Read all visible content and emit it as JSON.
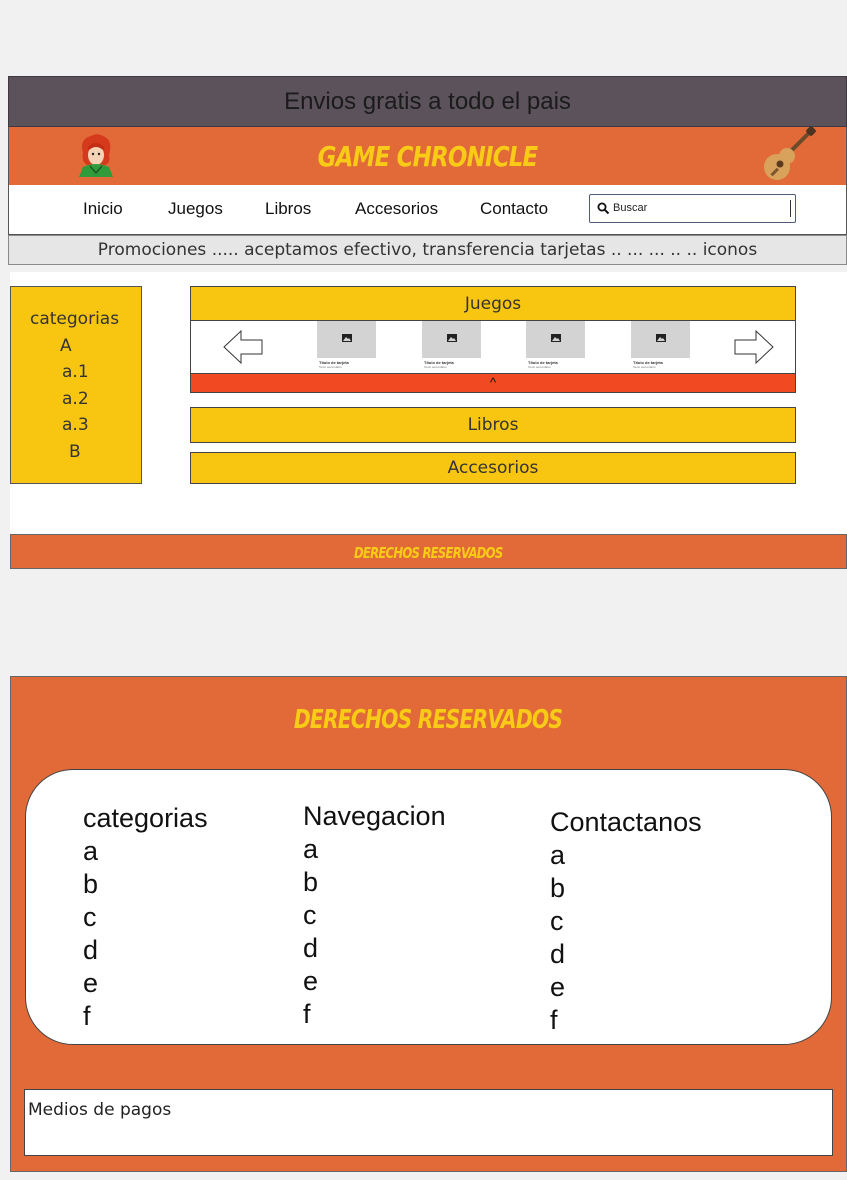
{
  "top_banner": {
    "text": "Envios gratis a todo el pais"
  },
  "header": {
    "brand": "GAME CHRONICLE"
  },
  "nav": {
    "items": [
      "Inicio",
      "Juegos",
      "Libros",
      "Accesorios",
      "Contacto"
    ],
    "search_placeholder": "Buscar"
  },
  "promo": {
    "text": "Promociones ..... aceptamos efectivo, transferencia tarjetas .. ... ... .. .. iconos"
  },
  "sidebar": {
    "title": "categorias",
    "items": [
      "A",
      "a.1",
      "a.2",
      "a.3",
      "B"
    ]
  },
  "sections": {
    "games": "Juegos",
    "carousel_toggle": "^",
    "cards": [
      {
        "title": "Título de tarjeta",
        "subtitle": "Texto secundario"
      },
      {
        "title": "Título de tarjeta",
        "subtitle": "Texto secundario"
      },
      {
        "title": "Título de tarjeta",
        "subtitle": "Texto secundario"
      },
      {
        "title": "Título de tarjeta",
        "subtitle": "Texto secundario"
      }
    ],
    "books": "Libros",
    "accessories": "Accesorios"
  },
  "footer_small": {
    "text": "DERECHOS RESERVADOS"
  },
  "footer": {
    "title": "DERECHOS RESERVADOS",
    "columns": [
      {
        "heading": "categorias",
        "items": [
          "a",
          "b",
          "c",
          "d",
          "e",
          "f"
        ]
      },
      {
        "heading": "Navegacion",
        "items": [
          "a",
          "b",
          "c",
          "d",
          "e",
          "f"
        ]
      },
      {
        "heading": "Contactanos",
        "items": [
          "a",
          "b",
          "c",
          "d",
          "e",
          "f"
        ]
      }
    ],
    "payments": "Medios de pagos"
  },
  "colors": {
    "orange": "#e26a38",
    "yellow": "#f8c610",
    "red_bar": "#f14a22",
    "banner_gray": "#5b525b"
  },
  "icons": [
    "avatar-icon",
    "guitar-icon",
    "search-icon",
    "arrow-left-icon",
    "arrow-right-icon",
    "image-icon"
  ]
}
